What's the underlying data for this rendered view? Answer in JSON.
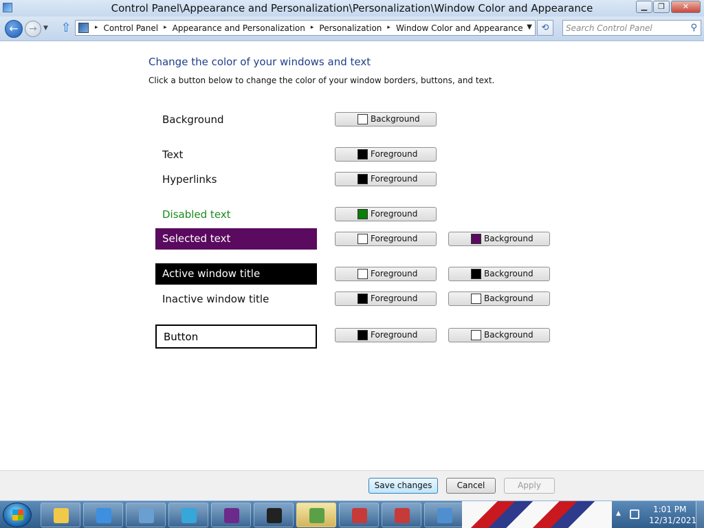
{
  "window": {
    "title": "Control Panel\\Appearance and Personalization\\Personalization\\Window Color and Appearance",
    "min_glyph": "▁",
    "max_glyph": "❐",
    "close_glyph": "✕"
  },
  "address": {
    "crumbs": [
      "Control Panel",
      "Appearance and Personalization",
      "Personalization",
      "Window Color and Appearance"
    ],
    "separator": "▸",
    "search_placeholder": "Search Control Panel"
  },
  "nav": {
    "back_glyph": "←",
    "forward_glyph": "→",
    "history_glyph": "▼",
    "up_glyph": "⇧",
    "refresh_glyph": "⟲",
    "dropdown_glyph": "▼",
    "search_glyph": "⚲"
  },
  "content": {
    "heading": "Change the color of your windows and text",
    "description": "Click a button below to change the color of your window borders, buttons, and text."
  },
  "items": [
    {
      "label": "Background",
      "buttons": [
        {
          "text": "Background",
          "color": "#ffffff"
        }
      ]
    },
    {
      "label": "Text",
      "buttons": [
        {
          "text": "Foreground",
          "color": "#000000"
        }
      ]
    },
    {
      "label": "Hyperlinks",
      "buttons": [
        {
          "text": "Foreground",
          "color": "#000000"
        }
      ]
    },
    {
      "label": "Disabled text",
      "label_color": "#1a8a1a",
      "buttons": [
        {
          "text": "Foreground",
          "color": "#0a7d0a"
        }
      ]
    },
    {
      "label": "Selected text",
      "label_bg": "#5a0a5f",
      "label_color": "#ffffff",
      "buttons": [
        {
          "text": "Foreground",
          "color": "#ffffff"
        },
        {
          "text": "Background",
          "color": "#5a0a5f"
        }
      ]
    },
    {
      "label": "Active window title",
      "label_bg": "#000000",
      "label_color": "#ffffff",
      "buttons": [
        {
          "text": "Foreground",
          "color": "#ffffff"
        },
        {
          "text": "Background",
          "color": "#000000"
        }
      ]
    },
    {
      "label": "Inactive window title",
      "buttons": [
        {
          "text": "Foreground",
          "color": "#000000"
        },
        {
          "text": "Background",
          "color": "#ffffff"
        }
      ]
    },
    {
      "label": "Button",
      "label_border": "#000000",
      "buttons": [
        {
          "text": "Foreground",
          "color": "#000000"
        },
        {
          "text": "Background",
          "color": "#ffffff"
        }
      ]
    }
  ],
  "footer": {
    "save": "Save changes",
    "cancel": "Cancel",
    "apply": "Apply"
  },
  "taskbar": {
    "items": [
      {
        "name": "explorer-folder",
        "color": "#f1c94a"
      },
      {
        "name": "internet-explorer",
        "color": "#3d8fe0"
      },
      {
        "name": "picture-viewer",
        "color": "#6a9fd1"
      },
      {
        "name": "remote-app",
        "color": "#37a6d9"
      },
      {
        "name": "brave-browser",
        "color": "#6c2a8a"
      },
      {
        "name": "seven-zip",
        "color": "#222222"
      },
      {
        "name": "network-monitor",
        "color": "#5aa046"
      },
      {
        "name": "toolbox-red",
        "color": "#c63a3a"
      },
      {
        "name": "toolbox-red-2",
        "color": "#c63a3a"
      },
      {
        "name": "control-panel",
        "color": "#4f8fd0"
      }
    ],
    "clock_time": "1:01 PM",
    "clock_date": "12/31/2021"
  }
}
